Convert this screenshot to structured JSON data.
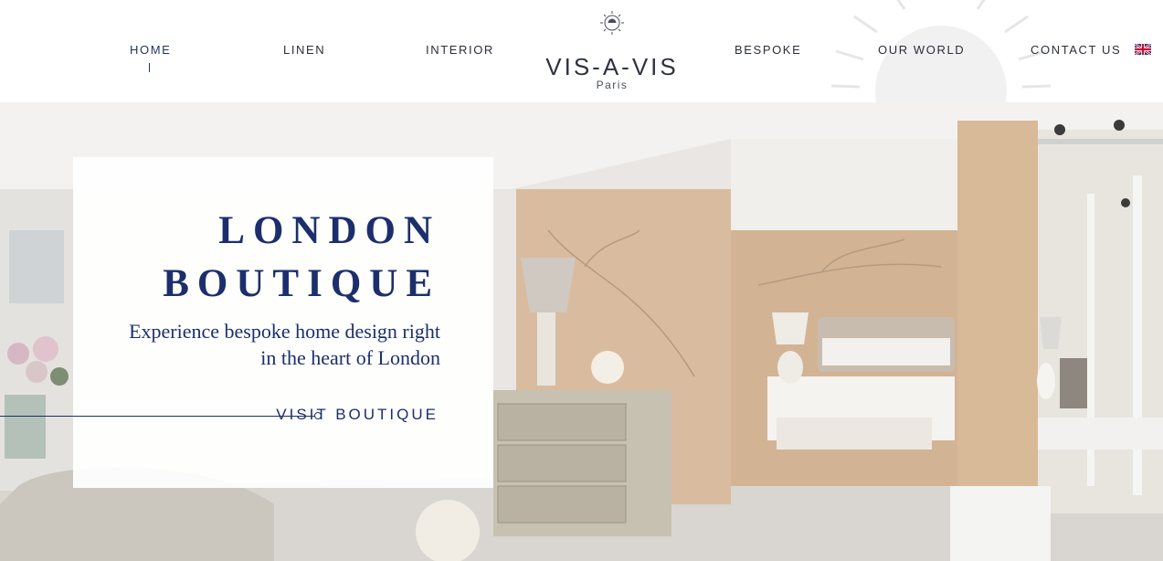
{
  "nav": {
    "items": [
      {
        "label": "HOME",
        "active": true
      },
      {
        "label": "LINEN",
        "active": false
      },
      {
        "label": "INTERIOR",
        "active": false
      },
      {
        "label": "BESPOKE",
        "active": false
      },
      {
        "label": "OUR WORLD",
        "active": false
      },
      {
        "label": "CONTACT US",
        "active": false
      }
    ],
    "language_icon": "uk-flag-icon"
  },
  "logo": {
    "name": "VIS-A-VIS",
    "city": "Paris",
    "emblem_icon": "sun-emblem-icon"
  },
  "hero": {
    "title_line1": "LONDON",
    "title_line2": "BOUTIQUE",
    "subtitle_line1": "Experience bespoke home design right",
    "subtitle_line2": "in the heart of London",
    "cta_label": "VISIT BOUTIQUE"
  },
  "colors": {
    "brand_navy": "#1c2f6c",
    "text_dark": "#2b2f3a",
    "wall_wood": "#d7b99c"
  }
}
